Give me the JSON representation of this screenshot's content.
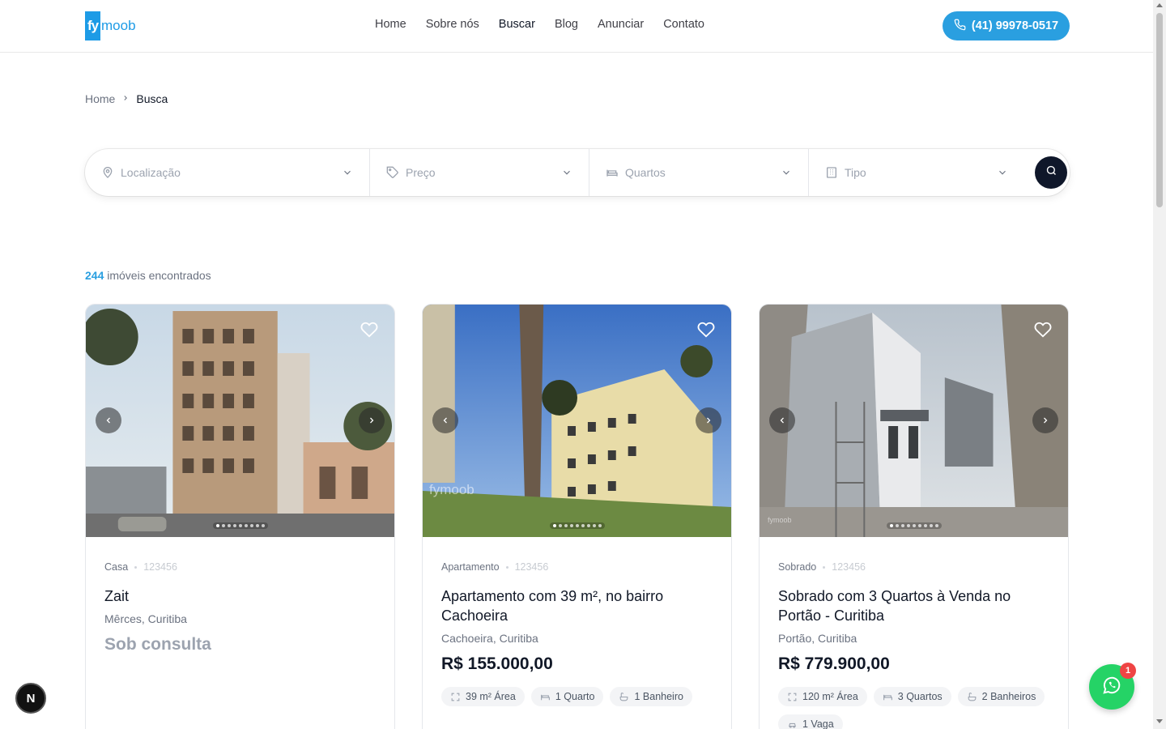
{
  "header": {
    "logo": {
      "mark": "fy",
      "text": "moob"
    },
    "nav": [
      {
        "label": "Home",
        "active": false
      },
      {
        "label": "Sobre nós",
        "active": false
      },
      {
        "label": "Buscar",
        "active": true
      },
      {
        "label": "Blog",
        "active": false
      },
      {
        "label": "Anunciar",
        "active": false
      },
      {
        "label": "Contato",
        "active": false
      }
    ],
    "phone": "(41) 99978-0517",
    "phone_icon": "phone-icon"
  },
  "breadcrumb": {
    "home": "Home",
    "current": "Busca"
  },
  "search": {
    "location": "Localização",
    "price": "Preço",
    "bedrooms": "Quartos",
    "type": "Tipo"
  },
  "results": {
    "count": "244",
    "label": "imóveis encontrados"
  },
  "cards": [
    {
      "type": "Casa",
      "code": "123456",
      "title": "Zait",
      "location": "Mêrces, Curitiba",
      "price": "Sob consulta",
      "features": []
    },
    {
      "type": "Apartamento",
      "code": "123456",
      "title": "Apartamento com 39 m², no bairro Cachoeira",
      "location": "Cachoeira, Curitiba",
      "price": "R$ 155.000,00",
      "features": [
        "39 m² Área",
        "1 Quarto",
        "1 Banheiro"
      ],
      "watermark": "fymoob"
    },
    {
      "type": "Sobrado",
      "code": "123456",
      "title": "Sobrado com 3 Quartos à Venda no Portão - Curitiba",
      "location": "Portão, Curitiba",
      "price": "R$ 779.900,00",
      "features": [
        "120 m² Área",
        "3 Quartos",
        "2 Banheiros",
        "1 Vaga"
      ],
      "watermark": "fymoob"
    }
  ],
  "floating": {
    "next_badge": "N",
    "whatsapp_count": "1"
  },
  "colors": {
    "accent": "#2a9fe0",
    "dark": "#0f172a",
    "whatsapp": "#25d366"
  }
}
